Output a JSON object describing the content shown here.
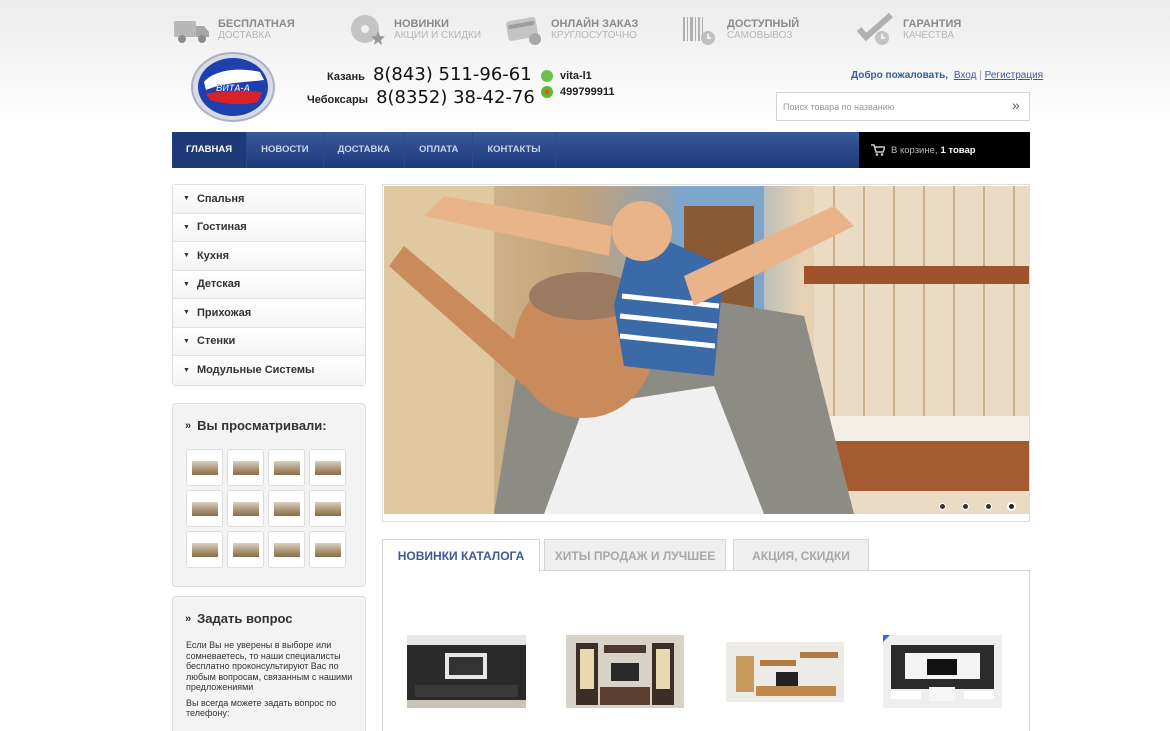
{
  "features": [
    {
      "icon": "delivery-truck-icon",
      "title": "Бесплатная",
      "sub": "доставка"
    },
    {
      "icon": "new-disc-star-icon",
      "title": "Новинки",
      "sub": "акции и скидки"
    },
    {
      "icon": "online-order-card-icon",
      "title": "Онлайн заказ",
      "sub": "круглосуточно"
    },
    {
      "icon": "barcode-clock-icon",
      "title": "Доступный",
      "sub": "самовывоз"
    },
    {
      "icon": "guarantee-check-icon",
      "title": "Гарантия",
      "sub": "качества"
    }
  ],
  "logo_text": "ВИТА-А",
  "phones": [
    {
      "city": "Казань",
      "number": "8(843) 511-96-61"
    },
    {
      "city": "Чебоксары",
      "number": "8(8352) 38-42-76"
    }
  ],
  "contacts": {
    "skype": "vita-l1",
    "icq": "499799911"
  },
  "auth": {
    "welcome": "Добро пожаловать,",
    "login": "Вход",
    "sep": "|",
    "register": "Регистрация"
  },
  "search": {
    "placeholder": "Поиск товара по названию",
    "go": "»"
  },
  "nav": [
    "ГЛАВНАЯ",
    "НОВОСТИ",
    "ДОСТАВКА",
    "ОПЛАТА",
    "КОНТАКТЫ"
  ],
  "cart": {
    "text": "В корзине,",
    "count": "1 товар"
  },
  "categories": [
    "Спальня",
    "Гостиная",
    "Кухня",
    "Детская",
    "Прихожая",
    "Стенки",
    "Модульные Системы"
  ],
  "viewed": {
    "title": "Вы просматривали:"
  },
  "ask": {
    "title": "Задать вопрос",
    "text": "Если Вы не уверены в выборе или сомневаетесь, то наши специалисты бесплатно проконсультируют Вас по любым вопросам, связанным с нашими предложениями",
    "text2": "Вы всегда можете задать вопрос по телефону:"
  },
  "tabs": [
    "Новинки каталога",
    "Хиты продаж и лучшее",
    "Акция, скидки"
  ],
  "colors": {
    "nav": "#2a4a8a",
    "accent": "#3a5a98",
    "cart_bg": "#000000"
  }
}
